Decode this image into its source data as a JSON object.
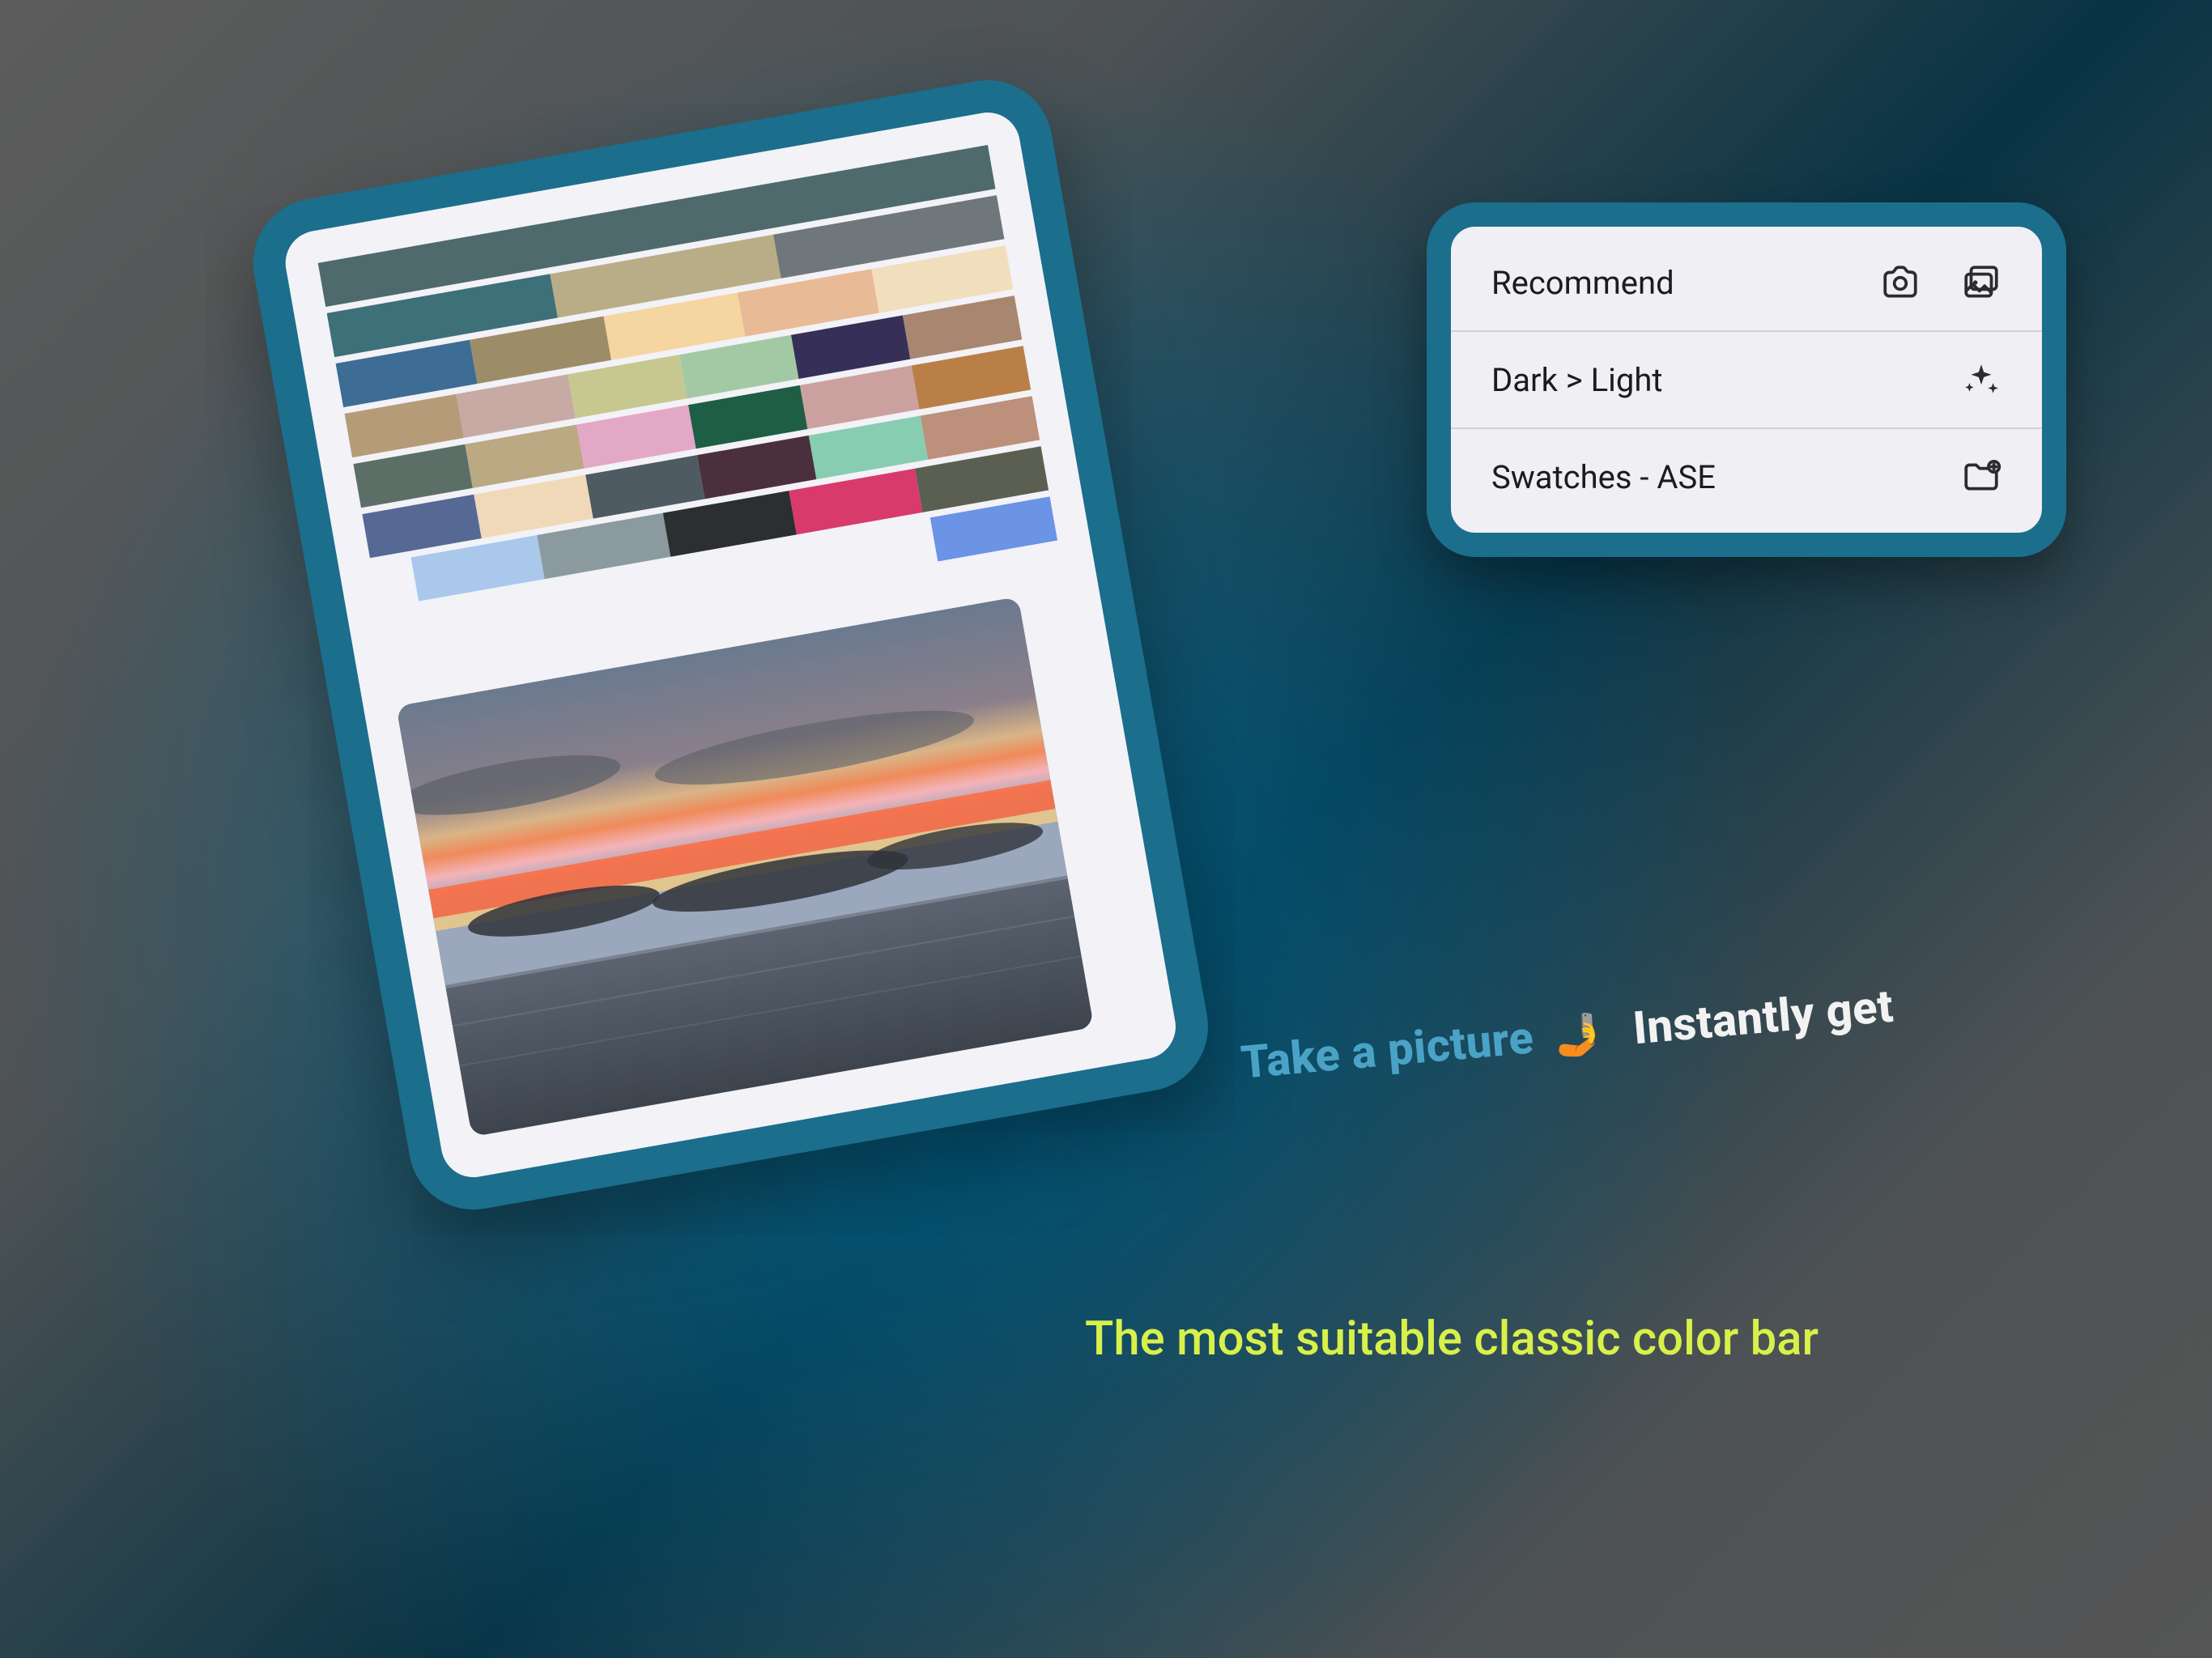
{
  "palette": {
    "rows": [
      {
        "offset": false,
        "colors": [
          "#4e6a6c"
        ]
      },
      {
        "offset": false,
        "colors": [
          "#3d7079",
          "#b9ad88",
          "#6f777a"
        ]
      },
      {
        "offset": false,
        "colors": [
          "#3d6c94",
          "#9c8d68",
          "#f5d5a0",
          "#e9ba96",
          "#f1debc"
        ]
      },
      {
        "offset": false,
        "colors": [
          "#b59b77",
          "#c6aaa3",
          "#c6c88f",
          "#a2c9a3",
          "#363058",
          "#a8866f"
        ]
      },
      {
        "offset": false,
        "colors": [
          "#5c6f66",
          "#bba984",
          "#e3a8c6",
          "#1d5e45",
          "#cba1a0",
          "#b97f47"
        ]
      },
      {
        "offset": false,
        "colors": [
          "#566994",
          "#f0d9b8",
          "#4f5b62",
          "#4c2f3c",
          "#86cdb1",
          "#bc907a"
        ]
      },
      {
        "offset": true,
        "colors": [
          "#a9c8ec",
          "#8a9a9e",
          "#2b2f32",
          "#d83a6b",
          "#5a5f52"
        ]
      },
      {
        "offset": true,
        "colors": [
          "#6b93e6"
        ]
      }
    ],
    "last_row_align": "right"
  },
  "menu": {
    "rows": [
      {
        "label": "Recommend",
        "icons": [
          "camera-icon",
          "gallery-icon"
        ]
      },
      {
        "label": "Dark > Light",
        "icons": [
          "sparkle-icon"
        ]
      },
      {
        "label": "Swatches - ASE",
        "icons": [
          "folder-plus-icon"
        ]
      }
    ]
  },
  "taglines": {
    "part_a": "Take a picture",
    "emoji": "🤳",
    "part_b": "Instantly get",
    "subtitle": "The most suitable classic color bar"
  }
}
